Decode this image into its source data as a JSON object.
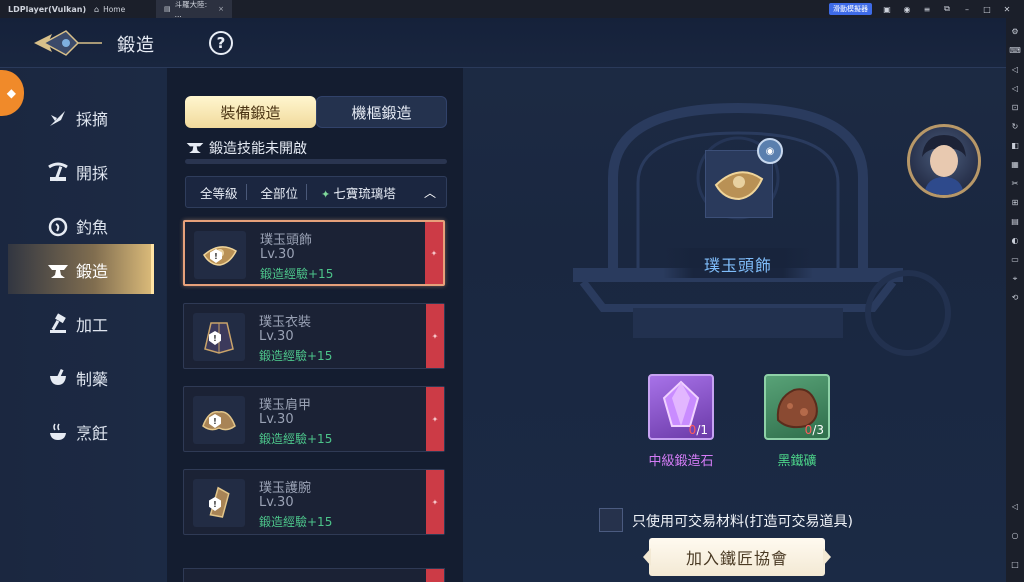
{
  "titlebar": {
    "app_name": "LDPlayer(Vulkan)",
    "home_tab": "Home",
    "game_tab": "斗羅大陸: ...",
    "badge": "滑動模擬器",
    "close_tab_icon": "×"
  },
  "header": {
    "title": "鍛造",
    "help": "?"
  },
  "categories": [
    {
      "label": "採摘",
      "icon": "herb-icon"
    },
    {
      "label": "開採",
      "icon": "pickaxe-icon"
    },
    {
      "label": "釣魚",
      "icon": "fishing-icon"
    },
    {
      "label": "鍛造",
      "icon": "anvil-icon",
      "active": true
    },
    {
      "label": "加工",
      "icon": "hammer-icon"
    },
    {
      "label": "制藥",
      "icon": "mortar-icon"
    },
    {
      "label": "烹飪",
      "icon": "cooking-icon"
    }
  ],
  "tabs": {
    "equipment": "裝備鍛造",
    "mechanism": "機樞鍛造"
  },
  "skill_status": "鍛造技能未開啟",
  "filters": {
    "level": "全等級",
    "slot": "全部位",
    "set": "七寶琉璃塔"
  },
  "items": [
    {
      "name": "璞玉頭飾",
      "level": "Lv.30",
      "exp": "鍛造經驗+15",
      "selected": true
    },
    {
      "name": "璞玉衣裝",
      "level": "Lv.30",
      "exp": "鍛造經驗+15"
    },
    {
      "name": "璞玉肩甲",
      "level": "Lv.30",
      "exp": "鍛造經驗+15"
    },
    {
      "name": "璞玉護腕",
      "level": "Lv.30",
      "exp": "鍛造經驗+15"
    }
  ],
  "detail": {
    "name": "璞玉頭飾",
    "materials": [
      {
        "name": "中級鍛造石",
        "owned": "0",
        "required": "/1",
        "color": "#d47cf6"
      },
      {
        "name": "黑鐵礦",
        "owned": "0",
        "required": "/3",
        "color": "#4cd489"
      }
    ],
    "checkbox_label": "只使用可交易材料(打造可交易道具)",
    "join_button": "加入鐵匠協會"
  },
  "colors": {
    "accent_gold": "#f1da9c",
    "item_exp_green": "#4cc48a",
    "detail_name_blue": "#7fbdfa",
    "card_tab_red": "#cc3b46"
  }
}
